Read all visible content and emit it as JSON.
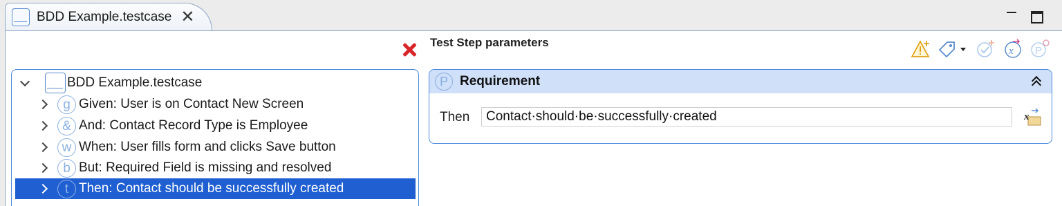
{
  "tab": {
    "title": "BDD Example.testcase",
    "close_icon": "close-icon"
  },
  "window": {
    "minimize_icon": "minimize-icon",
    "maximize_icon": "maximize-icon"
  },
  "toolbar": {
    "delete_icon": "red-x-delete-icon"
  },
  "tree": {
    "root": {
      "label": "BDD Example.testcase"
    },
    "items": [
      {
        "glyph": "g",
        "label": "Given: User is on Contact New Screen"
      },
      {
        "glyph": "&",
        "label": "And: Contact Record Type is Employee"
      },
      {
        "glyph": "w",
        "label": "When: User fills form and clicks Save button"
      },
      {
        "glyph": "b",
        "label": "But: Required Field is missing and resolved"
      },
      {
        "glyph": "t",
        "label": "Then: Contact should be successfully created",
        "selected": true
      }
    ]
  },
  "params": {
    "title": "Test Step parameters",
    "toolbar_icons": [
      "warning-add-icon",
      "tag-dropdown-icon",
      "check-add-icon",
      "variable-icon",
      "parameter-add-icon"
    ]
  },
  "requirement": {
    "glyph": "P",
    "title": "Requirement",
    "field_label": "Then",
    "field_value": "Contact·should·be·successfully·created"
  },
  "colors": {
    "selection": "#1f5fd1",
    "panel_border": "#4a89dc",
    "section_header": "#cfe0f8",
    "delete_red": "#d8252a"
  }
}
